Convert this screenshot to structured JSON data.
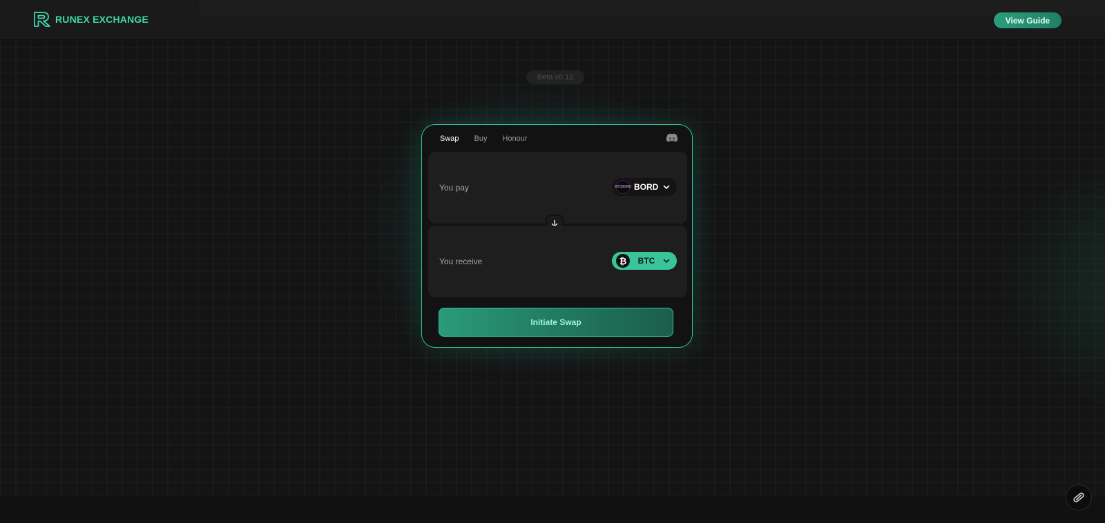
{
  "header": {
    "brand": "RUNEX EXCHANGE",
    "guide_label": "View Guide"
  },
  "beta_label": "Beta v0.12",
  "card": {
    "tabs": [
      {
        "label": "Swap",
        "active": true
      },
      {
        "label": "Buy",
        "active": false
      },
      {
        "label": "Honour",
        "active": false
      }
    ],
    "pay": {
      "label": "You pay",
      "token": "BORD",
      "token_icon_text": "BTCBORD"
    },
    "receive": {
      "label": "You receive",
      "token": "BTC",
      "token_icon_glyph": "₿"
    },
    "initiate_label": "Initiate Swap"
  },
  "colors": {
    "accent": "#3fd8ac",
    "button": "#2b9e7c",
    "background": "#151515"
  },
  "icons": {
    "discord": "discord-icon",
    "swap_arrow": "arrow-down-icon",
    "fab": "link-icon"
  }
}
